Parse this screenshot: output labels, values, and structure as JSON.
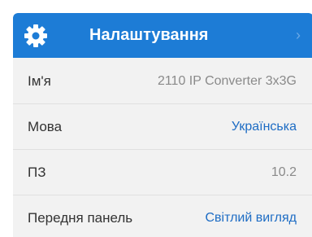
{
  "header": {
    "title": "Налаштування",
    "icon": "gear-icon",
    "chevron": "›",
    "color": "#1d7cd6"
  },
  "rows": [
    {
      "label": "Ім'я",
      "value": "2110 IP Converter 3x3G",
      "style": "plain"
    },
    {
      "label": "Мова",
      "value": "Українська",
      "style": "link"
    },
    {
      "label": "ПЗ",
      "value": "10.2",
      "style": "plain"
    },
    {
      "label": "Передня панель",
      "value": "Світлий вигляд",
      "style": "link"
    }
  ]
}
